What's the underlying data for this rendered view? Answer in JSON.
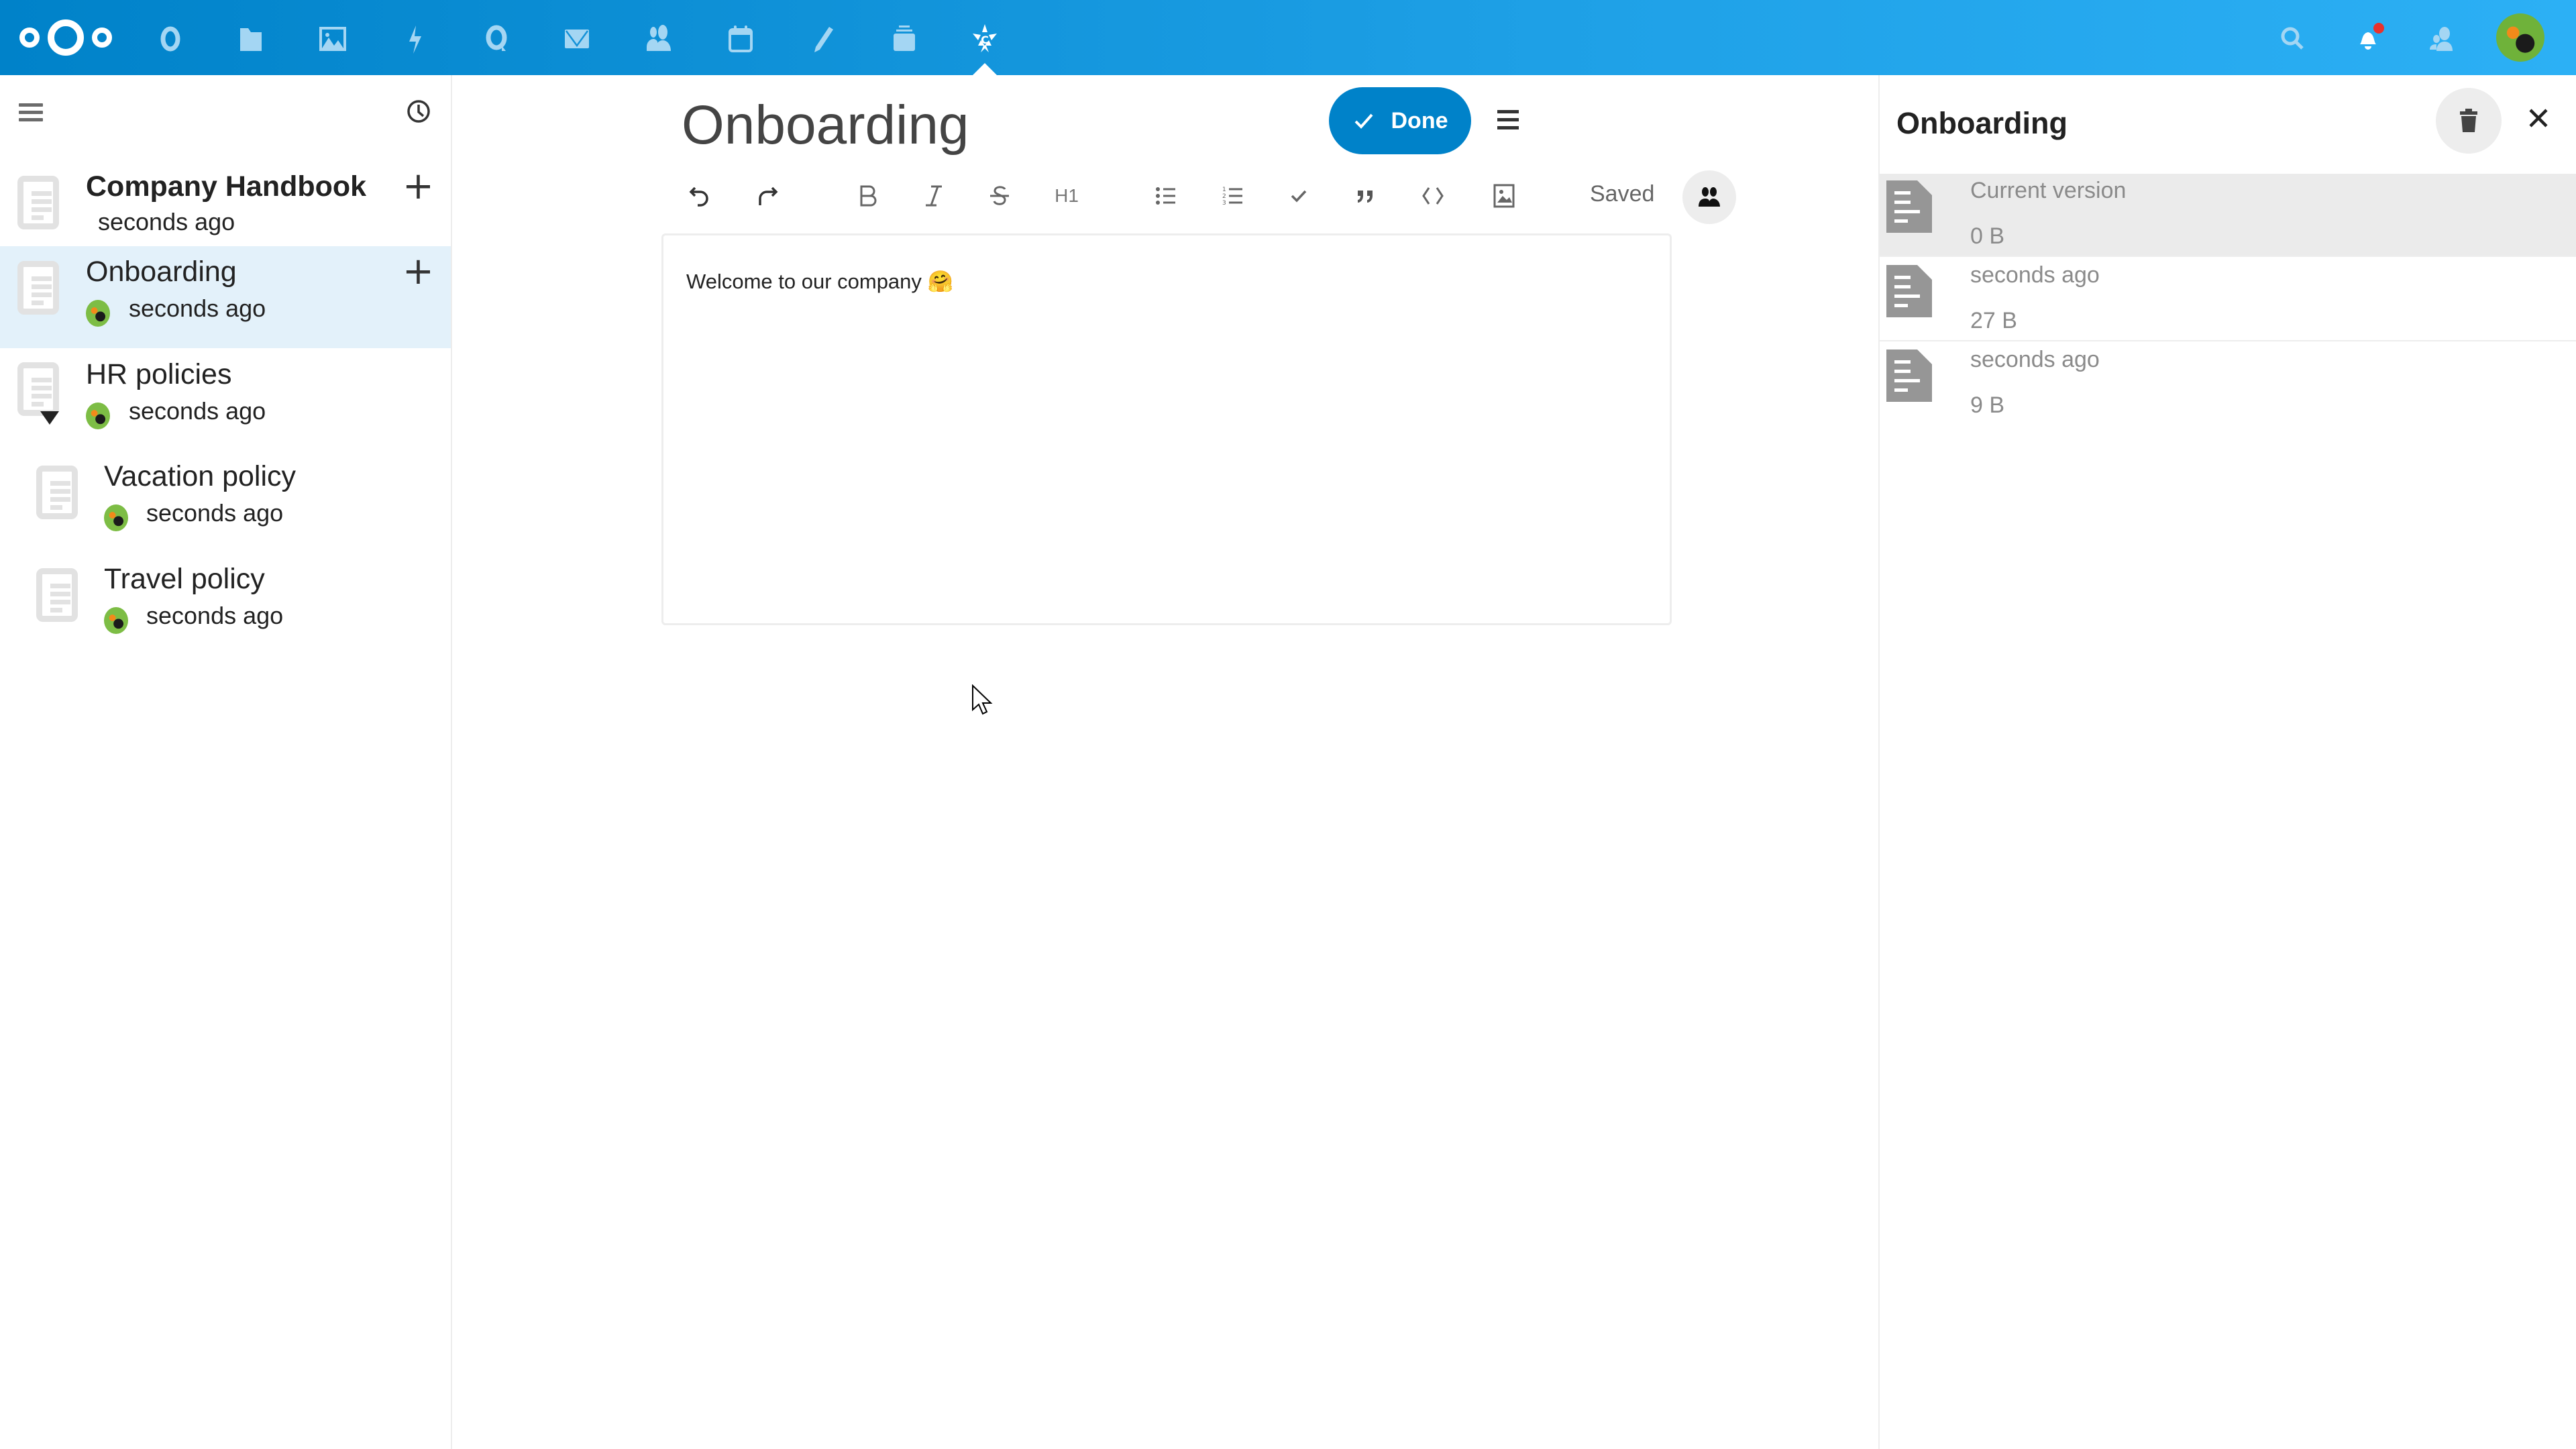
{
  "header": {
    "logo": "nextcloud-logo",
    "apps": [
      {
        "name": "dashboard",
        "icon": "circle-icon"
      },
      {
        "name": "files",
        "icon": "folder-icon"
      },
      {
        "name": "photos",
        "icon": "image-icon"
      },
      {
        "name": "activity",
        "icon": "lightning-icon"
      },
      {
        "name": "talk",
        "icon": "talk-bubble-icon"
      },
      {
        "name": "mail",
        "icon": "mail-icon"
      },
      {
        "name": "contacts",
        "icon": "contacts-icon"
      },
      {
        "name": "calendar",
        "icon": "calendar-icon"
      },
      {
        "name": "notes",
        "icon": "pencil-icon"
      },
      {
        "name": "deck",
        "icon": "deck-icon"
      },
      {
        "name": "collectives",
        "icon": "collectives-star-icon",
        "active": true
      }
    ],
    "right": [
      "search-icon",
      "notifications-icon",
      "contacts-menu-icon",
      "user-avatar"
    ],
    "notification_badge": true,
    "brand_color": "#0082c9"
  },
  "left_nav": {
    "pages": [
      {
        "title": "Company Handbook",
        "meta": "seconds ago",
        "bold": true,
        "has_add": true,
        "has_avatar": false
      },
      {
        "title": "Onboarding",
        "meta": "seconds ago",
        "active": true,
        "has_add": true,
        "has_avatar": true
      },
      {
        "title": "HR policies",
        "meta": "seconds ago",
        "expanded": true,
        "has_avatar": true
      },
      {
        "title": "Vacation policy",
        "meta": "seconds ago",
        "indent": 1,
        "has_avatar": true
      },
      {
        "title": "Travel policy",
        "meta": "seconds ago",
        "indent": 1,
        "has_avatar": true
      }
    ]
  },
  "editor": {
    "title": "Onboarding",
    "done_label": "Done",
    "status": "Saved",
    "toolbar": [
      "undo",
      "redo",
      "bold",
      "italic",
      "strikethrough",
      "H1",
      "bullet-list",
      "numbered-list",
      "checklist",
      "blockquote",
      "code",
      "insert-image"
    ],
    "h1_label": "H1",
    "content": "Welcome to our company 🤗"
  },
  "versions_sidebar": {
    "title": "Onboarding",
    "versions": [
      {
        "label": "Current version",
        "size": "0 B",
        "current": true
      },
      {
        "label": "seconds ago",
        "size": "27 B"
      },
      {
        "label": "seconds ago",
        "size": "9 B"
      }
    ]
  }
}
